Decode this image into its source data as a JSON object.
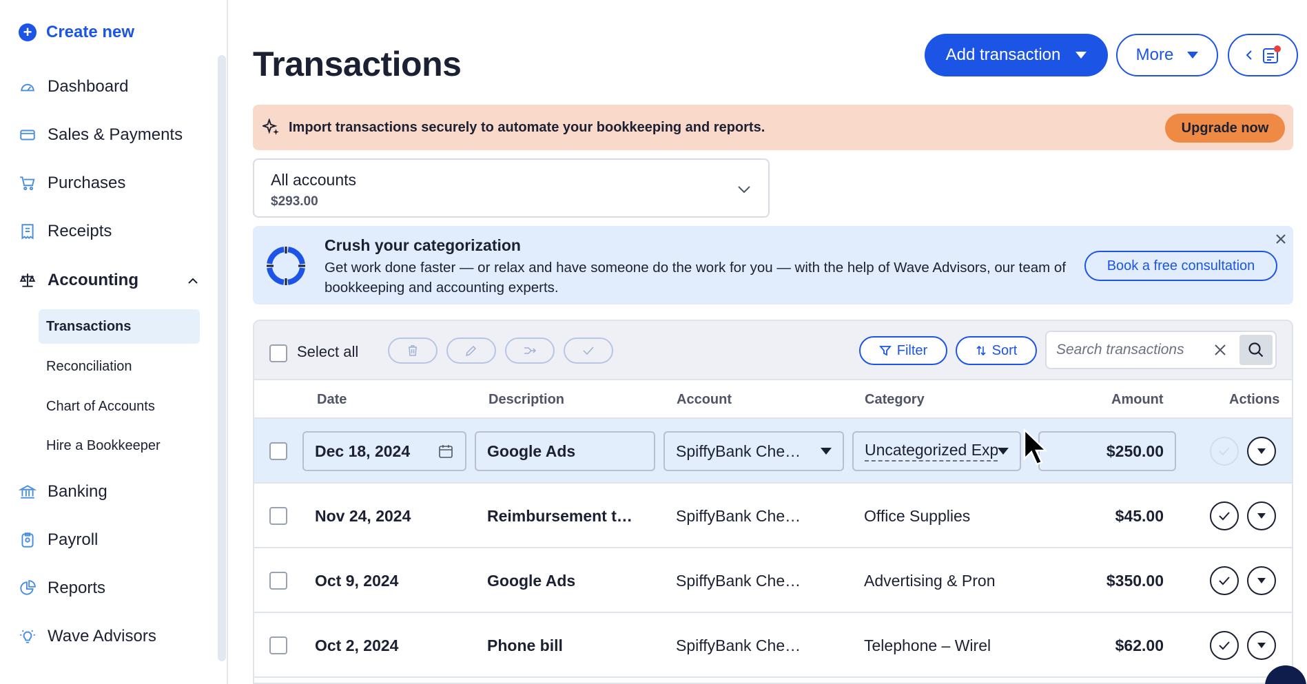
{
  "sidebar": {
    "create_label": "Create new",
    "items": [
      {
        "label": "Dashboard",
        "icon": "gauge-icon"
      },
      {
        "label": "Sales & Payments",
        "icon": "credit-card-icon"
      },
      {
        "label": "Purchases",
        "icon": "cart-icon"
      },
      {
        "label": "Receipts",
        "icon": "receipt-icon"
      },
      {
        "label": "Accounting",
        "icon": "scales-icon"
      },
      {
        "label": "Banking",
        "icon": "bank-icon"
      },
      {
        "label": "Payroll",
        "icon": "payroll-icon"
      },
      {
        "label": "Reports",
        "icon": "pie-chart-icon"
      },
      {
        "label": "Wave Advisors",
        "icon": "lightbulb-icon"
      }
    ],
    "accounting_sub": [
      "Transactions",
      "Reconciliation",
      "Chart of Accounts",
      "Hire a Bookkeeper"
    ],
    "active_sub": "Transactions"
  },
  "header": {
    "title": "Transactions",
    "add_label": "Add transaction",
    "more_label": "More"
  },
  "upgrade": {
    "text": "Import transactions securely to automate your bookkeeping and reports.",
    "button": "Upgrade now"
  },
  "account": {
    "name": "All accounts",
    "balance": "$293.00"
  },
  "advisor": {
    "title": "Crush your categorization",
    "body": "Get work done faster — or relax and have someone do the work for you — with the help of Wave Advisors, our team of bookkeeping and accounting experts.",
    "button": "Book a free consultation"
  },
  "toolbar": {
    "select_all": "Select all",
    "filter": "Filter",
    "sort": "Sort",
    "search_placeholder": "Search transactions"
  },
  "columns": {
    "date": "Date",
    "description": "Description",
    "account": "Account",
    "category": "Category",
    "amount": "Amount",
    "actions": "Actions"
  },
  "rows": [
    {
      "date": "Dec 18, 2024",
      "description": "Google Ads",
      "account": "SpiffyBank Che…",
      "category": "Uncategorized Exp",
      "amount": "$250.00"
    },
    {
      "date": "Nov 24, 2024",
      "description": "Reimbursement t…",
      "account": "SpiffyBank Che…",
      "category": "Office Supplies",
      "amount": "$45.00"
    },
    {
      "date": "Oct 9, 2024",
      "description": "Google Ads",
      "account": "SpiffyBank Che…",
      "category": "Advertising & Pron",
      "amount": "$350.00"
    },
    {
      "date": "Oct 2, 2024",
      "description": "Phone bill",
      "account": "SpiffyBank Che…",
      "category": "Telephone – Wirel",
      "amount": "$62.00"
    }
  ],
  "colors": {
    "brand": "#1c55e6",
    "upgrade_bg": "#f9d9c9",
    "upgrade_button": "#ef8a45",
    "advisor_bg": "#e1edfc",
    "selected_row": "#e2eefc"
  }
}
